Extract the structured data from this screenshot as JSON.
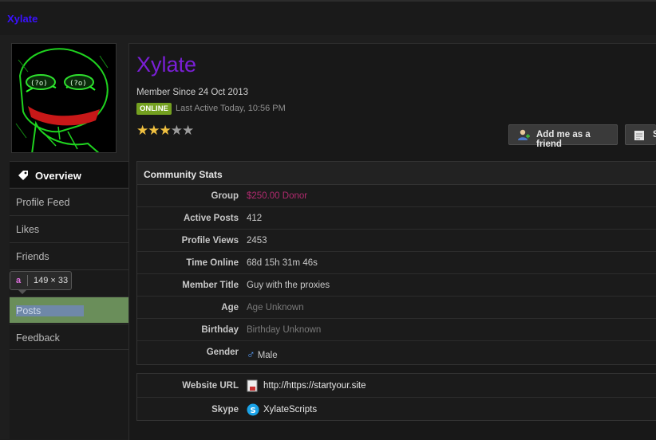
{
  "site": {
    "title": "Xylate"
  },
  "profile": {
    "username": "Xylate",
    "member_since": "Member Since 24 Oct 2013",
    "status_badge": "ONLINE",
    "last_active": "Last Active Today, 10:56 PM",
    "rating": {
      "filled": 3,
      "total": 5
    }
  },
  "buttons": {
    "add_friend": "Add me as a friend",
    "second": "S"
  },
  "nav": {
    "items": [
      {
        "label": "Overview"
      },
      {
        "label": "Profile Feed"
      },
      {
        "label": "Likes"
      },
      {
        "label": "Friends"
      },
      {
        "label": ""
      },
      {
        "label": "Posts"
      },
      {
        "label": "Feedback"
      }
    ]
  },
  "inspector_tooltip": {
    "tag": "a",
    "dims": "149 × 33"
  },
  "stats": {
    "header": "Community Stats",
    "rows": [
      {
        "label": "Group",
        "value": "$250.00 Donor"
      },
      {
        "label": "Active Posts",
        "value": "412"
      },
      {
        "label": "Profile Views",
        "value": "2453"
      },
      {
        "label": "Time Online",
        "value": "68d 15h 31m 46s"
      },
      {
        "label": "Member Title",
        "value": "Guy with the proxies"
      },
      {
        "label": "Age",
        "value": "Age Unknown"
      },
      {
        "label": "Birthday",
        "value": "Birthday Unknown"
      },
      {
        "label": "Gender",
        "value": "Male"
      }
    ]
  },
  "contact": {
    "rows": [
      {
        "label": "Website URL",
        "value": "http://https://startyour.site"
      },
      {
        "label": "Skype",
        "value": "XylateScripts"
      }
    ]
  },
  "colors": {
    "username": "#7a1fd6",
    "site_title": "#3a12ff",
    "online": "#74a020",
    "donor": "#b02a6e"
  }
}
